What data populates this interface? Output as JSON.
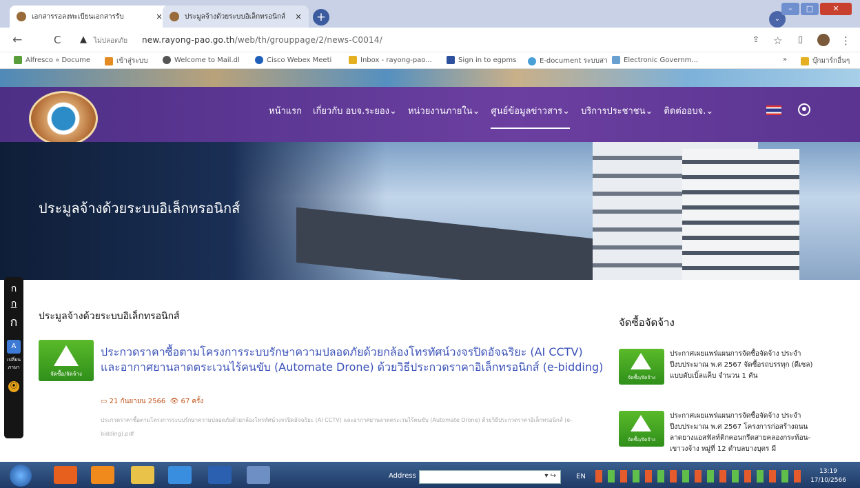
{
  "browser": {
    "tabs": [
      {
        "title": "เอกสารรอลงทะเบียนเอกสารรับ",
        "close": "×"
      },
      {
        "title": "ประมูลจ้างด้วยระบบอิเล็กทรอนิกส์",
        "close": "×"
      }
    ],
    "new_tab": "+",
    "profile_dropdown": "⌄",
    "window_controls": {
      "minimize": "–",
      "maximize": "□",
      "close": "✕"
    },
    "back": "←",
    "reload": "C",
    "warning": "▲",
    "security_text": "ไม่ปลอดภัย",
    "url_host": "new.rayong-pao.go.th",
    "url_path": "/web/th/grouppage/2/news-C0014/",
    "toolbar_icons": [
      "share-icon",
      "star-icon",
      "sidebar-icon",
      "profile-icon",
      "menu-icon"
    ],
    "bookmarks": [
      {
        "label": "Alfresco » Docume",
        "color": "#5a9e3b"
      },
      {
        "label": "เข้าสู่ระบบ",
        "color": "#e48b22"
      },
      {
        "label": "Welcome to Mail.dl",
        "color": "#555555"
      },
      {
        "label": "Cisco Webex Meeti",
        "color": "#1f5fb8"
      },
      {
        "label": "Inbox - rayong-pao...",
        "color": "#e4b022"
      },
      {
        "label": "Sign in to egpms",
        "color": "#2c4f9e"
      },
      {
        "label": "E-document ระบบสา",
        "color": "#49a0d8"
      },
      {
        "label": "Electronic Governm...",
        "color": "#6aa0d0"
      }
    ],
    "bookmarks_more": "»",
    "other_bookmarks": "บุ๊กมาร์กอื่นๆ"
  },
  "site": {
    "menu": [
      "หน้าแรก",
      "เกี่ยวกับ อบจ.ระยอง⌄",
      "หน่วยงานภายใน⌄",
      "ศูนย์ข้อมูลข่าวสาร⌄",
      "บริการประชาชน⌄",
      "ติดต่ออบจ.⌄"
    ],
    "hero_title": "ประมูลจ้างด้วยระบบอิเล็กทรอนิกส์",
    "a11y": {
      "font_small": "ก",
      "font_medium": "ก",
      "font_large": "ก",
      "translate": "A",
      "translate_label": "เปลี่ยน ภาษา",
      "guide": "⦿"
    },
    "section_title": "ประมูลจ้างด้วยระบบอิเล็กทรอนิกส์",
    "thumb_label": "จัดซื้อ/จัดจ้าง",
    "article": {
      "title": "ประกวดราคาซื้อตามโครงการระบบรักษาความปลอดภัยด้วยกล้องโทรทัศน์วงจรปิดอัจฉริยะ (AI CCTV) และอากาศยานลาดตระเวนไร้คนขับ (Automate Drone) ด้วยวิธีประกวดราคาอิเล็กทรอนิกส์ (e-bidding)",
      "date": "▭ 21 กันยายน 2566",
      "views": "👁 67 ครั้ง",
      "description": "ประกวดราคาซื้อตามโครงการระบบรักษาความปลอดภัยด้วยกล้องโทรทัศน์วงจรปิดอัจฉริยะ (AI CCTV) และอากาศยานลาดตระเวนไร้คนขับ (Automate Drone) ด้วยวิธีประกวดราคาอิเล็กทรอนิกส์ (e-bidding).pdf"
    },
    "sidebar_title": "จัดซื้อจัดจ้าง",
    "sidebar_items": [
      {
        "text": "ประกาศเผยแพร่แผนการจัดซื้อจัดจ้าง ประจำปีงบประมาณ พ.ศ 2567 จัดซื้อรถบรรทุก (ดีเซล) แบบดับเบิ้ลแค็บ จำนวน 1 คัน"
      },
      {
        "text": "ประกาศเผยแพร่แผนการจัดซื้อจัดจ้าง ประจำปีงบประมาณ พ.ศ 2567 โครงการก่อสร้างถนนลาดยางแอสฟัลท์ติกคอนกรีตสายคลองกระท้อน-เขาวงจ้าง หมู่ที่ 12 ตำบลบางบุตร มี"
      }
    ]
  },
  "taskbar": {
    "address_label": "Address",
    "address_go": "▾ ↪",
    "lang": "EN",
    "time": "13:19",
    "date": "17/10/2566"
  }
}
